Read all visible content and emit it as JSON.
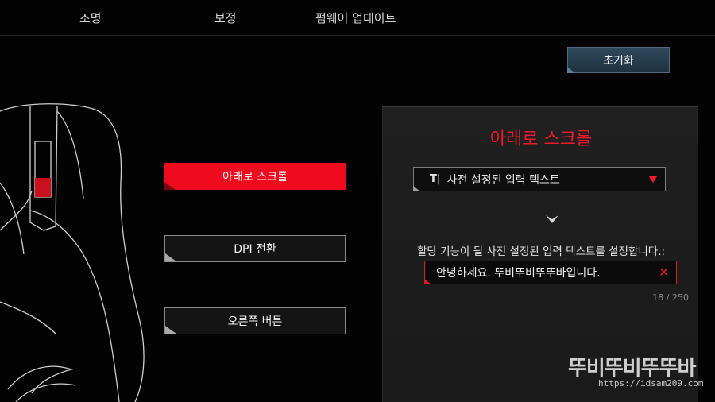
{
  "nav": {
    "tabs": [
      {
        "label": "조명"
      },
      {
        "label": "보정"
      },
      {
        "label": "펌웨어 업데이트"
      }
    ]
  },
  "toolbar": {
    "reset_label": "초기화"
  },
  "functions": [
    {
      "label": "아래로 스크롤",
      "active": true
    },
    {
      "label": "DPI 전환",
      "active": false
    },
    {
      "label": "오른쪽 버튼",
      "active": false
    }
  ],
  "panel": {
    "title": "아래로 스크롤",
    "dropdown": {
      "icon": "text-cursor-icon",
      "icon_glyph": "T|",
      "value": "사전 설정된 입력 텍스트"
    },
    "description": "할당 기능이 될 사전 설정된 입력 텍스트를 설정합니다.:",
    "input_value": "안녕하세요. 뚜비뚜비뚜뚜바입니다.",
    "counter": "18 / 250"
  },
  "watermark": {
    "title": "뚜비뚜비뚜뚜바",
    "url": "https://idsam209.com"
  },
  "colors": {
    "accent": "#f00a1d",
    "panel_bg": "#1e1e1e",
    "reset_btn": "#2a4456",
    "background": "#030303"
  }
}
